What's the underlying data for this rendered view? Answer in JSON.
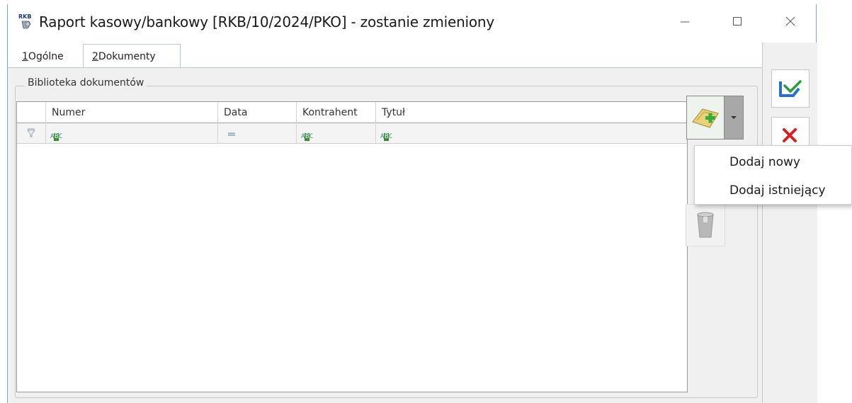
{
  "window": {
    "title": "Raport kasowy/bankowy [RKB/10/2024/PKO] - zostanie zmieniony",
    "app_icon_label": "RKB"
  },
  "tabs": [
    {
      "key": "1",
      "label": " Ogólne",
      "active": false
    },
    {
      "key": "2",
      "label": " Dokumenty",
      "active": true
    }
  ],
  "group": {
    "label": "Biblioteka dokumentów"
  },
  "grid": {
    "columns": [
      "Numer",
      "Data",
      "Kontrahent",
      "Tytuł"
    ],
    "filter_icons": [
      "filter-icon",
      "abc-text-filter-icon",
      "equals-filter-icon",
      "abc-text-filter-icon",
      "abc-text-filter-icon"
    ],
    "rows": []
  },
  "dropdown": {
    "items": [
      "Dodaj nowy",
      "Dodaj istniejący"
    ]
  },
  "colors": {
    "save_accent": "#2a6fc9",
    "cancel_accent": "#d42020",
    "add_accent": "#3aaa3a"
  }
}
